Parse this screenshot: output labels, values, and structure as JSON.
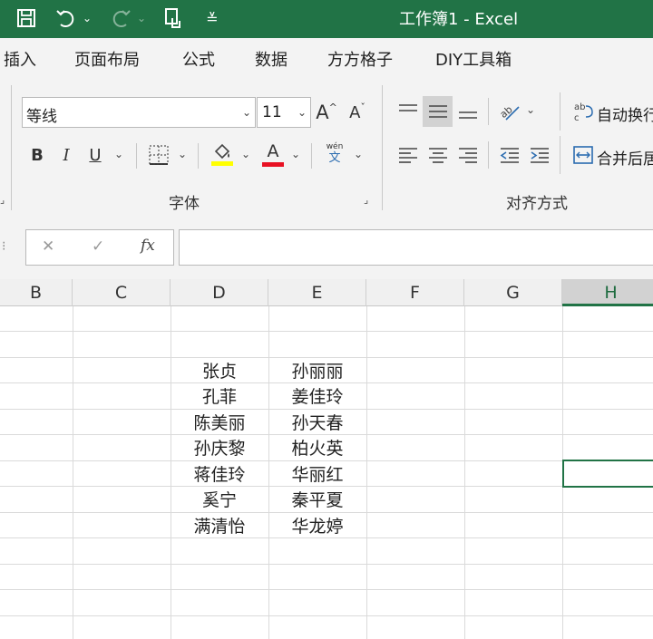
{
  "window": {
    "title": "工作簿1  -  Excel"
  },
  "quick_access": {
    "icons": [
      "save-icon",
      "undo-icon",
      "redo-icon",
      "touch-mode-icon",
      "customize-icon"
    ]
  },
  "menu_tabs": [
    "插入",
    "页面布局",
    "公式",
    "数据",
    "方方格子",
    "DIY工具箱"
  ],
  "ribbon": {
    "font_group": {
      "label": "字体",
      "font_name": "等线",
      "font_size": "11",
      "increase_font_label": "A",
      "decrease_font_label": "A",
      "bold_label": "B",
      "italic_label": "I",
      "underline_label": "U",
      "font_color_label": "A",
      "phonetic_top": "wén",
      "phonetic_bottom": "文",
      "highlight_color": "#FFFF00",
      "font_color": "#E81123"
    },
    "alignment_group": {
      "label": "对齐方式",
      "wrap_text_label": "自动换行",
      "merge_label": "合并后居"
    }
  },
  "formula_bar": {
    "cancel_label": "✕",
    "enter_label": "✓",
    "function_label": "fx",
    "value": ""
  },
  "sheet": {
    "columns": [
      "B",
      "C",
      "D",
      "E",
      "F",
      "G",
      "H"
    ],
    "selected_column": "H",
    "column_D": [
      "张贞",
      "孔菲",
      "陈美丽",
      "孙庆黎",
      "蒋佳玲",
      "奚宁",
      "满清怡"
    ],
    "column_E": [
      "孙丽丽",
      "姜佳玲",
      "孙天春",
      "柏火英",
      "华丽红",
      "秦平夏",
      "华龙婷"
    ]
  },
  "colors": {
    "accent": "#217346"
  }
}
